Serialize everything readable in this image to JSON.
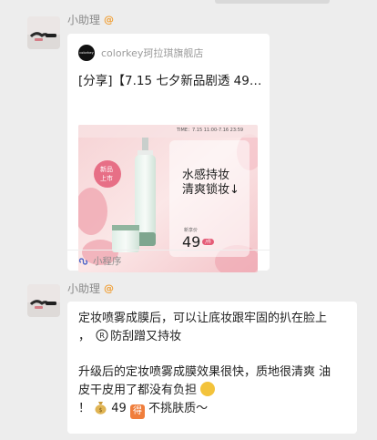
{
  "messages": [
    {
      "sender": "小助理",
      "badge": "@",
      "card": {
        "logo_text": "colorkey",
        "source": "colorkey珂拉琪旗舰店",
        "title": "[分享]【7.15 七夕新品剧透 49…",
        "image": {
          "time_text": "TIME：7.15 11:00-7.16 23:59",
          "badge_line1": "新品",
          "badge_line2": "上市",
          "headline1": "水感持妆",
          "headline2": "清爽锁妆↓",
          "price_label": "新享价",
          "price": "49",
          "price_unit": "/件"
        },
        "footer_label": "小程序"
      }
    },
    {
      "sender": "小助理",
      "badge": "@",
      "lines": {
        "l1": "定妆喷雾成膜后，可以让底妆跟牢固的扒在脸上",
        "l2a": "，",
        "l2b": "防刮蹭又持妆",
        "l3": "升级后的定妆喷雾成膜效果很快，质地很清爽 油",
        "l4": "皮干皮用了都没有负担",
        "l5a": "！",
        "l5b": " 49 ",
        "l5c": "得",
        "l5d": " 不挑肤质～"
      }
    }
  ],
  "colors": {
    "background": "#ededed",
    "badge": "#f0a13a",
    "accent": "#f07e3c"
  }
}
